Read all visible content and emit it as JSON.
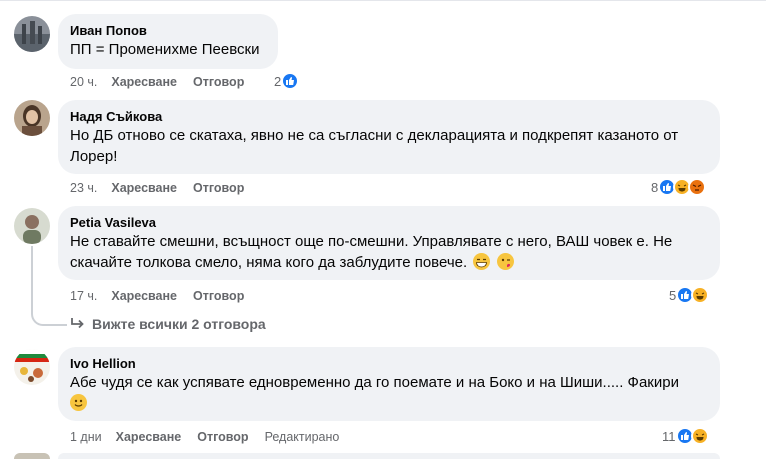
{
  "comments": [
    {
      "author": "Иван Попов",
      "text": "ПП = Променихме Пеевски",
      "time": "20 ч.",
      "like_label": "Харесване",
      "reply_label": "Отговор",
      "reaction_count": "2",
      "reactions": [
        "like"
      ]
    },
    {
      "author": "Надя Съйкова",
      "text_line1": "Но ДБ отново се скатаха, явно не са съгласни с декларацията и подкрепят казаното от",
      "text_line2": "Лорер!",
      "time": "23 ч.",
      "like_label": "Харесване",
      "reply_label": "Отговор",
      "reaction_count": "8",
      "reactions": [
        "like",
        "haha",
        "angry"
      ]
    },
    {
      "author": "Petia Vasileva",
      "text_line1": "Не ставайте смешни, всъщност още по-смешни. Управлявате с него, ВАШ човек е. Не",
      "text_line2": "скачайте толкова смело, няма кого да заблудите повече.",
      "emojis": [
        "grin-emoji",
        "wink-kiss-emoji"
      ],
      "time": "17 ч.",
      "like_label": "Харесване",
      "reply_label": "Отговор",
      "reaction_count": "5",
      "reactions": [
        "like",
        "haha"
      ]
    },
    {
      "author": "Ivo Hellion",
      "text_line1": "Абе чудя се как успявате едновременно да го поемате и на Боко и на Шиши..... Факири",
      "emojis": [
        "smile-emoji"
      ],
      "time": "1 дни",
      "like_label": "Харесване",
      "reply_label": "Отговор",
      "edited_label": "Редактирано",
      "reaction_count": "11",
      "reactions": [
        "like",
        "haha"
      ]
    }
  ],
  "view_replies": "Вижте всички 2 отговора",
  "colors": {
    "bubble": "#f0f2f5",
    "like": "#1877f2",
    "haha": "#f7b125",
    "angry": "#e9710f",
    "meta": "#65676b"
  }
}
